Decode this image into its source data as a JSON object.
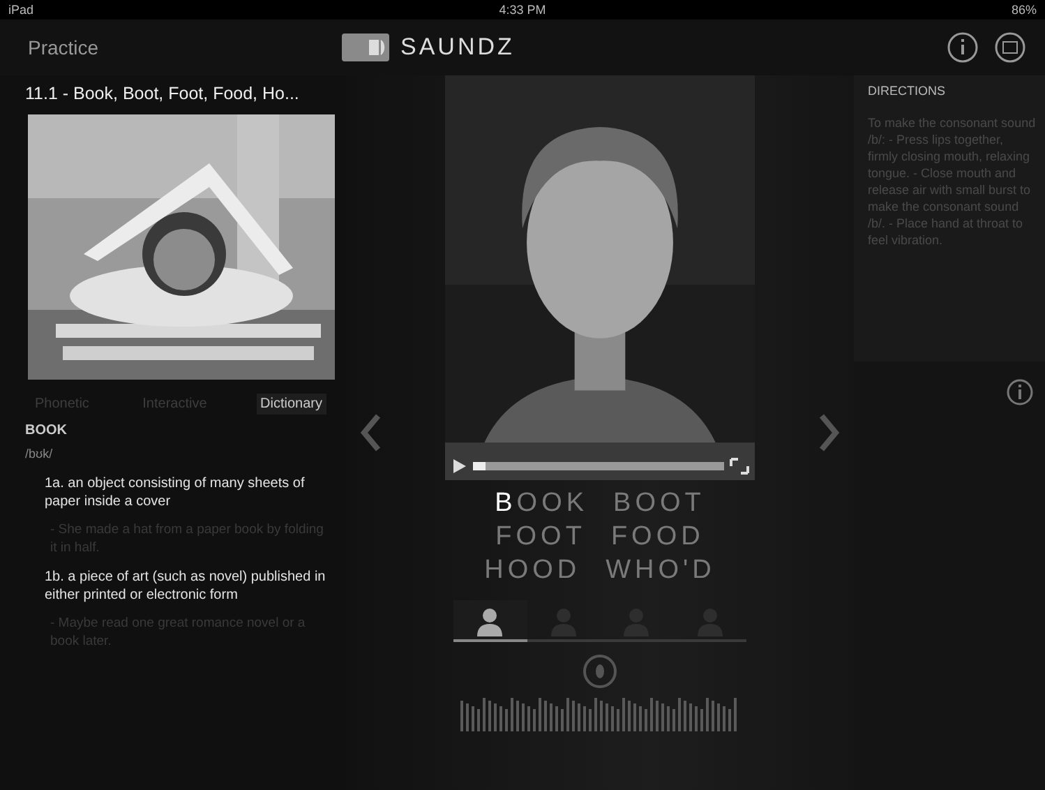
{
  "status_bar": {
    "carrier": "iPad",
    "time": "4:33 PM",
    "battery": "86%"
  },
  "header": {
    "back": "Practice",
    "logo": "SAUNDZ"
  },
  "lesson": {
    "title": "11.1 - Book, Boot, Foot, Food, Ho..."
  },
  "tabs": [
    {
      "label": "Phonetic",
      "selected": false
    },
    {
      "label": "Interactive",
      "selected": false
    },
    {
      "label": "Dictionary",
      "selected": true
    }
  ],
  "dictionary": {
    "word": "BOOK",
    "phonetic": "/bʊk/",
    "senses": [
      {
        "definition": "1a. an object consisting of many sheets of paper inside a cover",
        "example": "- She made a hat from a paper book by folding it in half."
      },
      {
        "definition": "1b. a piece of art (such as novel) published in either printed or electronic form",
        "example": "- Maybe read one great romance novel or a book later."
      }
    ]
  },
  "video": {
    "level": 0.05
  },
  "words": [
    "**B**OOK",
    "BOOT",
    "FOOT",
    "FOOD",
    "HOOD",
    "WHO'D"
  ],
  "speakers": [
    {
      "selected": true
    },
    {
      "selected": false
    },
    {
      "selected": false
    },
    {
      "selected": false
    }
  ],
  "directions": {
    "title": "DIRECTIONS",
    "text": "To make the consonant sound /b/: - Press lips together, firmly closing mouth, relaxing tongue. - Close mouth and release air with small burst to make the consonant sound /b/. - Place hand at throat to feel vibration."
  }
}
